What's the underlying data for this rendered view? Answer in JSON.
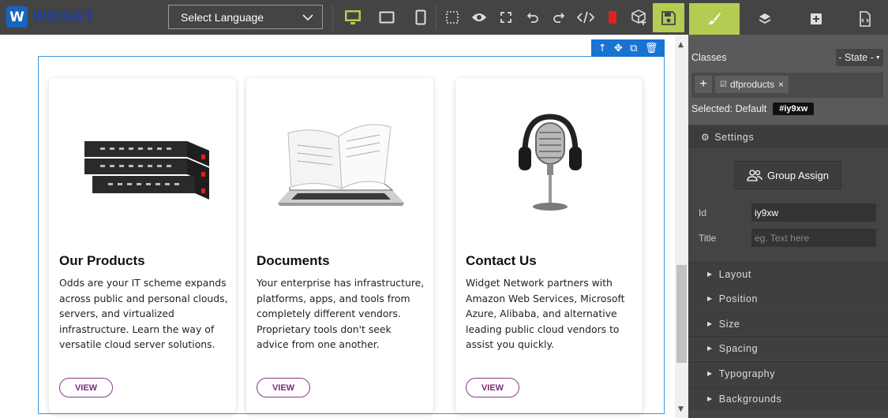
{
  "app": {
    "logo_letter": "W",
    "logo_text": "WIDGET"
  },
  "toolbar": {
    "language": "Select Language"
  },
  "canvas": {
    "cards": [
      {
        "title": "Our Products",
        "text": "Odds are your IT scheme expands across public and personal clouds, servers, and virtualized infrastructure. Learn the way of versatile cloud server solutions.",
        "button": "VIEW",
        "image": "server-rack"
      },
      {
        "title": "Documents",
        "text": "Your enterprise has infrastructure, platforms, apps, and tools from completely different vendors. Proprietary tools don't seek advice from one another.",
        "button": "VIEW",
        "image": "laptop-book"
      },
      {
        "title": "Contact Us",
        "text": "Widget Network partners with Amazon Web Services, Microsoft Azure, Alibaba, and alternative leading public cloud vendors to assist you quickly.",
        "button": "VIEW",
        "image": "headphones-mic"
      }
    ]
  },
  "sidebar": {
    "classes_label": "Classes",
    "state_label": "- State -",
    "tag_label": "dfproducts",
    "selected_label": "Selected: Default",
    "selected_id": "#iy9xw",
    "settings_label": "Settings",
    "group_assign": "Group Assign",
    "id_label": "Id",
    "id_value": "iy9xw",
    "title_label": "Title",
    "title_placeholder": "eg. Text here",
    "sectors": [
      "Layout",
      "Position",
      "Size",
      "Spacing",
      "Typography",
      "Backgrounds"
    ]
  },
  "colors": {
    "accent": "#b3cc52",
    "selection": "#1873d3",
    "button": "#7a2a7a"
  }
}
